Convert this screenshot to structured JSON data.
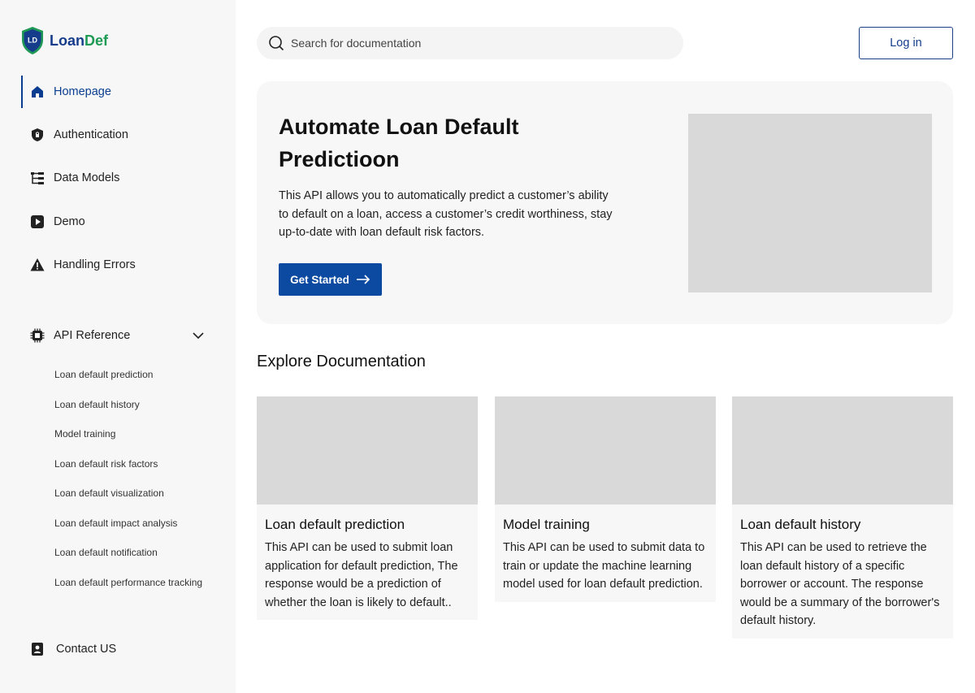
{
  "brand": {
    "logo_initials": "LD",
    "name_part1": "Loan",
    "name_part2": "Def"
  },
  "sidebar": {
    "items": [
      {
        "label": "Homepage",
        "icon": "home-icon"
      },
      {
        "label": "Authentication",
        "icon": "shield-lock-icon"
      },
      {
        "label": "Data Models",
        "icon": "tree-structure-icon"
      },
      {
        "label": "Demo",
        "icon": "play-icon"
      },
      {
        "label": "Handling Errors",
        "icon": "warning-icon"
      }
    ],
    "api_reference": {
      "label": "API Reference",
      "icon": "chip-icon",
      "subitems": [
        "Loan default prediction",
        "Loan default history",
        "Model training",
        "Loan default risk factors",
        "Loan default visualization",
        "Loan default impact analysis",
        "Loan default notification",
        "Loan default performance tracking"
      ]
    },
    "contact": {
      "label": "Contact US",
      "icon": "contact-badge-icon"
    }
  },
  "search": {
    "placeholder": "Search for documentation"
  },
  "header": {
    "login_label": "Log in"
  },
  "hero": {
    "title": "Automate Loan Default Predictioon",
    "description": "This API allows you to automatically predict a customer’s ability to default on a loan, access a customer’s credit worthiness, stay up-to-date with loan default risk factors.",
    "cta_label": "Get Started"
  },
  "explore": {
    "title": "Explore Documentation",
    "cards": [
      {
        "title": "Loan default prediction",
        "description": "This API can be used to submit loan application for default prediction, The response would be a prediction of whether the loan is likely to default.."
      },
      {
        "title": "Model training",
        "description": "This API can be used to submit data to train or update the machine learning model used for loan default prediction."
      },
      {
        "title": "Loan default history",
        "description": "This API can be used to retrieve the loan default history of a specific borrower or account. The response would be a summary of the borrower's default history."
      }
    ]
  },
  "colors": {
    "primary": "#0b4aa0",
    "brand_blue": "#163d8c",
    "brand_green": "#1f9a55",
    "sidebar_bg": "#f7f7f7",
    "placeholder_gray": "#d9d9d9"
  }
}
